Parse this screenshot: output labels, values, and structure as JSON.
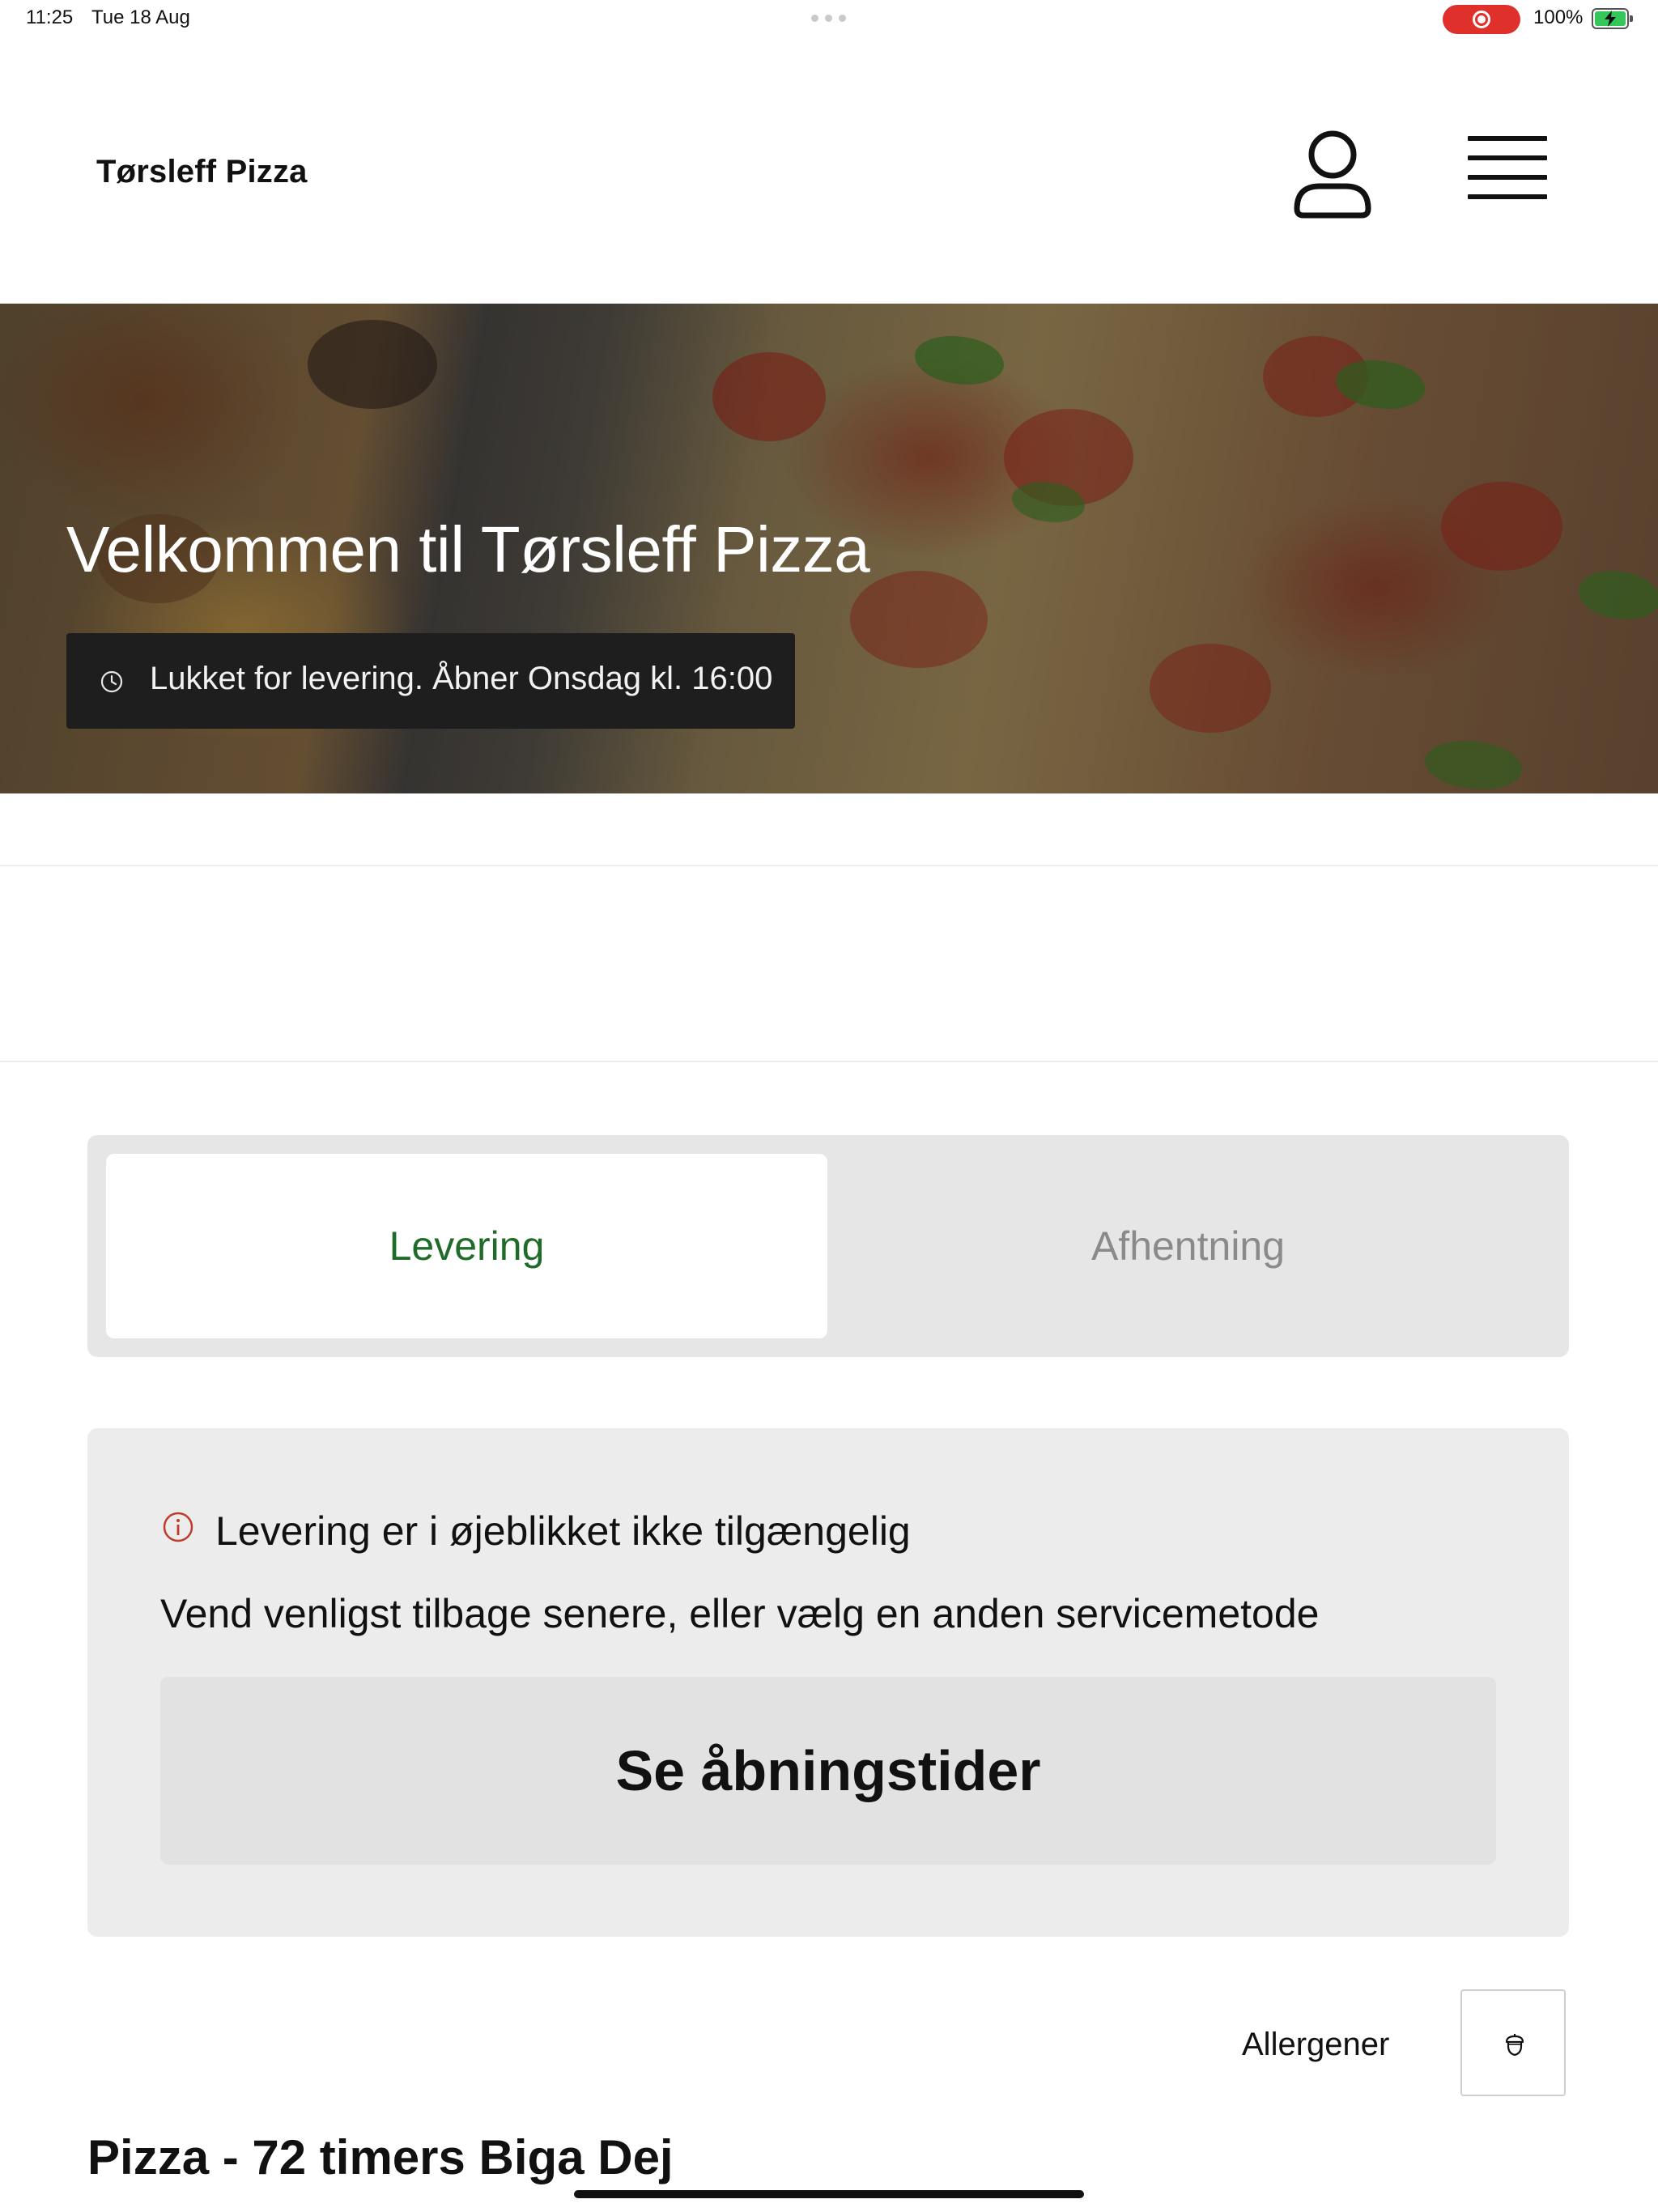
{
  "status_bar": {
    "time": "11:25",
    "date": "Tue 18 Aug",
    "battery_percent": "100%",
    "recording_color": "#e0302b",
    "battery_color": "#34c759"
  },
  "header": {
    "brand": "Tørsleff Pizza",
    "user_icon": "person-icon",
    "menu_icon": "hamburger-menu-icon"
  },
  "hero": {
    "title": "Velkommen til Tørsleff Pizza",
    "status_text": "Lukket for levering. Åbner Onsdag kl. 16:00",
    "status_icon": "clock-icon"
  },
  "service_toggle": {
    "options": [
      {
        "label": "Levering",
        "selected": true
      },
      {
        "label": "Afhentning",
        "selected": false
      }
    ],
    "active_color": "#1f6b28"
  },
  "notice": {
    "icon": "info-icon",
    "icon_color": "#c0392b",
    "title": "Levering er i øjeblikket ikke tilgængelig",
    "subtitle": "Vend venligst tilbage senere, eller vælg en anden servicemetode",
    "button_label": "Se åbningstider"
  },
  "allergens": {
    "label": "Allergener",
    "icon": "acorn-icon"
  },
  "menu_section": {
    "title": "Pizza - 72 timers Biga Dej"
  }
}
